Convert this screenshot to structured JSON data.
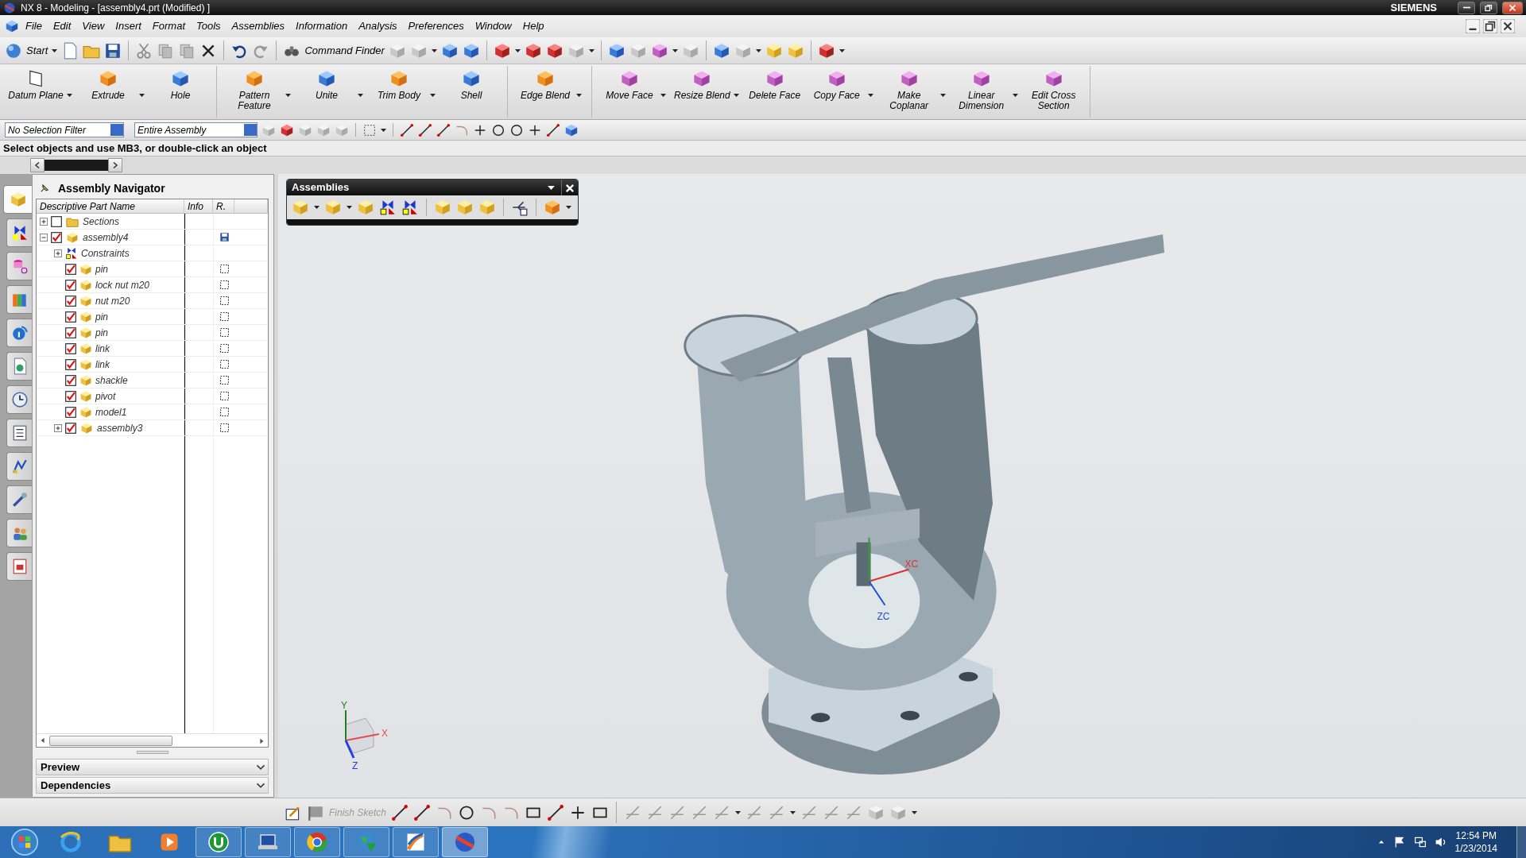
{
  "window": {
    "title": "NX 8 - Modeling - [assembly4.prt (Modified) ]",
    "brand": "SIEMENS"
  },
  "menu": [
    "File",
    "Edit",
    "View",
    "Insert",
    "Format",
    "Tools",
    "Assemblies",
    "Information",
    "Analysis",
    "Preferences",
    "Window",
    "Help"
  ],
  "standard_toolbar": {
    "start": "Start",
    "command_finder": "Command Finder"
  },
  "ribbon_groups": [
    {
      "buttons": [
        {
          "label": "Datum Plane",
          "has_menu": true
        },
        {
          "label": "Extrude",
          "has_menu": true
        },
        {
          "label": "Hole",
          "has_menu": false
        }
      ]
    },
    {
      "buttons": [
        {
          "label": "Pattern\nFeature",
          "has_menu": true
        },
        {
          "label": "Unite",
          "has_menu": true
        },
        {
          "label": "Trim Body",
          "has_menu": true
        },
        {
          "label": "Shell",
          "has_menu": false
        }
      ]
    },
    {
      "buttons": [
        {
          "label": "Edge Blend",
          "has_menu": true
        }
      ]
    },
    {
      "buttons": [
        {
          "label": "Move Face",
          "has_menu": true
        },
        {
          "label": "Resize Blend",
          "has_menu": true
        },
        {
          "label": "Delete Face",
          "has_menu": false
        },
        {
          "label": "Copy Face",
          "has_menu": true
        },
        {
          "label": "Make\nCoplanar",
          "has_menu": true
        },
        {
          "label": "Linear\nDimension",
          "has_menu": true
        },
        {
          "label": "Edit Cross\nSection",
          "has_menu": false
        }
      ]
    }
  ],
  "selection_bar": {
    "filter": "No Selection Filter",
    "scope": "Entire Assembly"
  },
  "cue_line": "Select objects and use MB3, or double-click an object",
  "resource_bar": {
    "tabs": [
      {
        "selected": true
      },
      {
        "selected": false
      },
      {
        "selected": false
      },
      {
        "selected": false
      },
      {
        "selected": false
      },
      {
        "selected": false
      },
      {
        "selected": false
      },
      {
        "selected": false
      },
      {
        "selected": false
      },
      {
        "selected": false
      },
      {
        "selected": false
      },
      {
        "selected": false
      }
    ]
  },
  "navigator": {
    "title": "Assembly Navigator",
    "columns": [
      "Descriptive Part Name",
      "Info",
      "R."
    ],
    "tree": [
      {
        "name": "Sections",
        "kind": "folder",
        "checked": false,
        "expanded": false
      },
      {
        "name": "assembly4",
        "kind": "assembly",
        "checked": true,
        "expanded": true,
        "modified": true,
        "children": [
          {
            "name": "Constraints",
            "kind": "constraints",
            "expanded": false
          },
          {
            "name": "pin",
            "kind": "part",
            "checked": true,
            "modified": false
          },
          {
            "name": "lock nut m20",
            "kind": "part",
            "checked": true,
            "modified": false
          },
          {
            "name": "nut m20",
            "kind": "part",
            "checked": true,
            "modified": false
          },
          {
            "name": "pin",
            "kind": "part",
            "checked": true,
            "modified": false
          },
          {
            "name": "pin",
            "kind": "part",
            "checked": true,
            "modified": false
          },
          {
            "name": "link",
            "kind": "part",
            "checked": true,
            "modified": false
          },
          {
            "name": "link",
            "kind": "part",
            "checked": true,
            "modified": false
          },
          {
            "name": "shackle",
            "kind": "part",
            "checked": true,
            "modified": false
          },
          {
            "name": "pivot",
            "kind": "part",
            "checked": true,
            "modified": false
          },
          {
            "name": "model1",
            "kind": "part",
            "checked": true,
            "modified": false
          },
          {
            "name": "assembly3",
            "kind": "assembly",
            "checked": true,
            "expanded": false,
            "modified": false
          }
        ]
      }
    ]
  },
  "panels": [
    {
      "label": "Preview",
      "expanded": false
    },
    {
      "label": "Dependencies",
      "expanded": false
    }
  ],
  "assemblies_toolbar": {
    "title": "Assemblies"
  },
  "view": {
    "wcs_labels": [
      "XC",
      "ZC"
    ],
    "triad_labels": [
      "Y",
      "X",
      "Z"
    ]
  },
  "sketch_toolbar": {
    "finish_sketch": "Finish Sketch",
    "disabled": true
  },
  "taskbar": {
    "apps": [
      {
        "running": false,
        "active": false
      },
      {
        "running": false,
        "active": false
      },
      {
        "running": false,
        "active": false
      },
      {
        "running": true,
        "active": false
      },
      {
        "running": true,
        "active": false
      },
      {
        "running": true,
        "active": false
      },
      {
        "running": true,
        "active": false
      },
      {
        "running": true,
        "active": false
      },
      {
        "running": true,
        "active": true
      }
    ],
    "time": "12:54 PM",
    "date": "1/23/2014"
  }
}
